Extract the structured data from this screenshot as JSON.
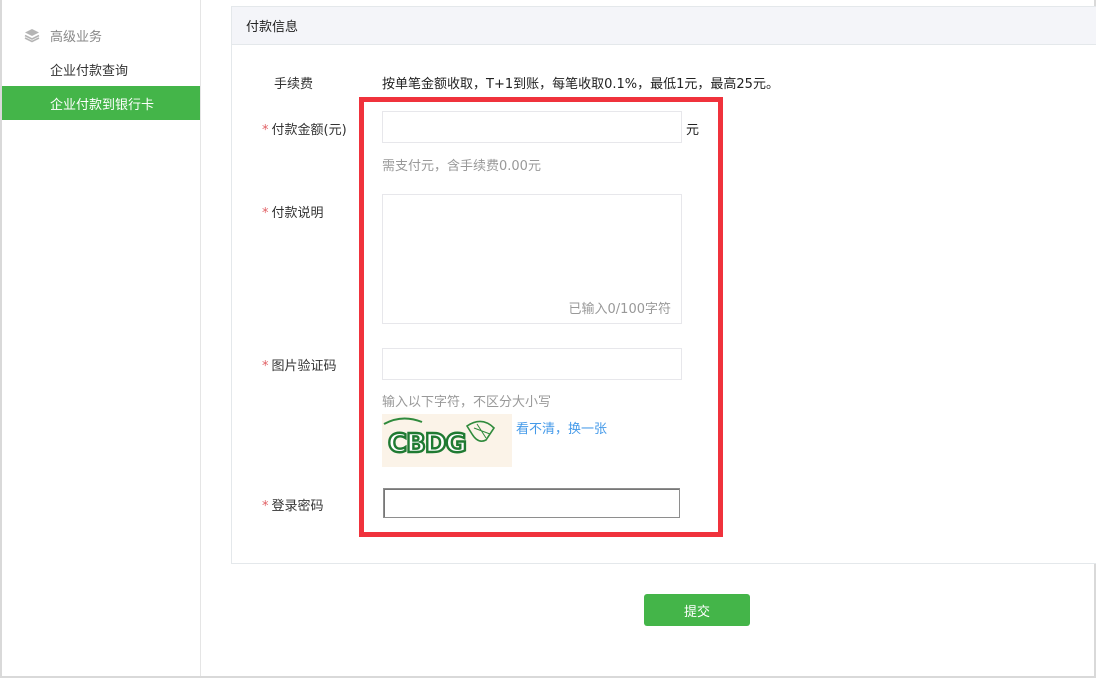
{
  "sidebar": {
    "group_label": "高级业务",
    "group_icon": "layers-icon",
    "items": [
      {
        "label": "企业付款查询",
        "active": false
      },
      {
        "label": "企业付款到银行卡",
        "active": true
      }
    ]
  },
  "panel": {
    "title": "付款信息",
    "fee": {
      "label": "手续费",
      "text": "按单笔金额收取，T+1到账，每笔收取0.1%，最低1元，最高25元。"
    },
    "amount": {
      "required_mark": "*",
      "label": "付款金额(元)",
      "value": "",
      "unit": "元",
      "tip": "需支付元，含手续费0.00元"
    },
    "description": {
      "required_mark": "*",
      "label": "付款说明",
      "value": "",
      "counter": "已输入0/100字符"
    },
    "captcha": {
      "required_mark": "*",
      "label": "图片验证码",
      "value": "",
      "tip": "输入以下字符，不区分大小写",
      "image_text": "CBDG",
      "refresh_link": "看不清，换一张"
    },
    "password": {
      "required_mark": "*",
      "label": "登录密码",
      "value": ""
    }
  },
  "submit_label": "提交",
  "colors": {
    "brand_green": "#44b549",
    "highlight_red": "#f0323c",
    "required_red": "#e15f63",
    "link_blue": "#459ae9"
  }
}
